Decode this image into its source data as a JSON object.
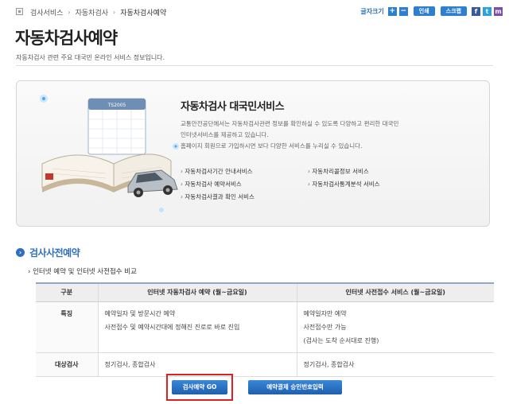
{
  "breadcrumb": {
    "items": [
      "검사서비스",
      "자동차검사",
      "자동차검사예약"
    ]
  },
  "toolbar": {
    "font_size_label": "글자크기",
    "plus": "+",
    "minus": "−",
    "print_label": "인쇄",
    "scrap_label": "스크랩",
    "social": [
      "f",
      "t",
      "m"
    ]
  },
  "page": {
    "title": "자동차검사예약",
    "subtitle": "자동차검사 관련 주요 대국민 온라인 서비스 정보입니다."
  },
  "banner": {
    "calendar_label": "TS2005",
    "title": "자동차검사 대국민서비스",
    "desc_line1": "교통안전공단에서는 자동차검사관련 정보를 확인하실 수 있도록 다양하고 편리한 대국민",
    "desc_line2": "인터넷서비스를 제공하고 있습니다.",
    "desc_line3": "홈페이지 회원으로 가입하시면 보다 다양한 서비스를 누리실 수 있습니다.",
    "services": [
      "자동차검사기간 안내서비스",
      "자동차리콜정보 서비스",
      "자동차검사 예약서비스",
      "자동차검사통계분석 서비스",
      "자동차검사결과 확인 서비스"
    ]
  },
  "section": {
    "title": "검사사전예약",
    "desc": "인터넷 예약 및 인터넷 사전접수 비교"
  },
  "table": {
    "headers": [
      "구분",
      "인터넷 자동차검사 예약 (월~금요일)",
      "인터넷 사전접수 서비스 (월~금요일)"
    ],
    "rows": [
      {
        "label": "특징",
        "col1": [
          "예약일자 및 방문시간 예약",
          "사전접수 및 예약시간대에 정해진 진로로 바로 진입"
        ],
        "col2": [
          "예약일자만 예약",
          "사전접수만 가능",
          "(검사는 도착 순서대로 진행)"
        ]
      },
      {
        "label": "대상검사",
        "col1": [
          "정기검사, 종합검사"
        ],
        "col2": [
          "정기검사, 종합검사"
        ]
      }
    ]
  },
  "buttons": {
    "go": "검사예약 GO",
    "approve": "예약결제 승인번호입력"
  },
  "colors": {
    "accent": "#2f6fbf",
    "highlight": "#e02020"
  }
}
